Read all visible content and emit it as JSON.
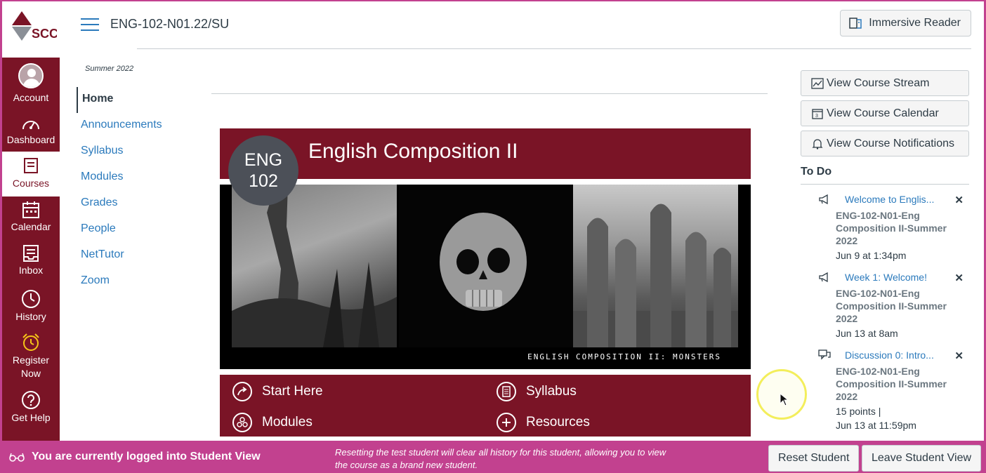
{
  "global_nav": {
    "logo_text": "SCC",
    "items": [
      {
        "label": "Account",
        "icon": "avatar"
      },
      {
        "label": "Dashboard",
        "icon": "dashboard-icon"
      },
      {
        "label": "Courses",
        "icon": "courses-icon"
      },
      {
        "label": "Calendar",
        "icon": "calendar-icon"
      },
      {
        "label": "Inbox",
        "icon": "inbox-icon"
      },
      {
        "label": "History",
        "icon": "history-icon"
      },
      {
        "label_line1": "Register",
        "label_line2": "Now",
        "icon": "alarm-clock-icon"
      },
      {
        "label": "Get Help",
        "icon": "help-icon"
      }
    ]
  },
  "header": {
    "course_code": "ENG-102-N01.22/SU",
    "immersive_reader": "Immersive Reader"
  },
  "course_nav": {
    "term": "Summer 2022",
    "items": [
      "Home",
      "Announcements",
      "Syllabus",
      "Modules",
      "Grades",
      "People",
      "NetTutor",
      "Zoom"
    ],
    "active": "Home"
  },
  "banner": {
    "badge_line1": "ENG",
    "badge_line2": "102",
    "title": "English Composition II",
    "caption": "ENGLISH COMPOSITION II: MONSTERS",
    "links": [
      "Start Here",
      "Syllabus",
      "Modules",
      "Resources"
    ]
  },
  "right_sidebar": {
    "buttons": [
      "View Course Stream",
      "View Course Calendar",
      "View Course Notifications"
    ],
    "todo_heading": "To Do",
    "todos": [
      {
        "title": "Welcome to Englis...",
        "course": "ENG-102-N01-Eng Composition II-Summer 2022",
        "meta1": "Jun 9 at 1:34pm",
        "icon": "announcement-icon"
      },
      {
        "title": "Week 1: Welcome!",
        "course": "ENG-102-N01-Eng Composition II-Summer 2022",
        "meta1": "Jun 13 at 8am",
        "icon": "announcement-icon"
      },
      {
        "title": "Discussion 0: Intro...",
        "course": "ENG-102-N01-Eng Composition II-Summer 2022",
        "meta1": "15 points  |",
        "meta2": "Jun 13 at 11:59pm",
        "icon": "discussion-icon"
      }
    ]
  },
  "student_view": {
    "message": "You are currently logged into Student View",
    "note": "Resetting the test student will clear all history for this student, allowing you to view the course as a brand new student.",
    "reset_label": "Reset Student",
    "leave_label": "Leave Student View"
  },
  "colors": {
    "brand": "#7a1426",
    "student_bar": "#c2418f",
    "link": "#2b7abc"
  }
}
